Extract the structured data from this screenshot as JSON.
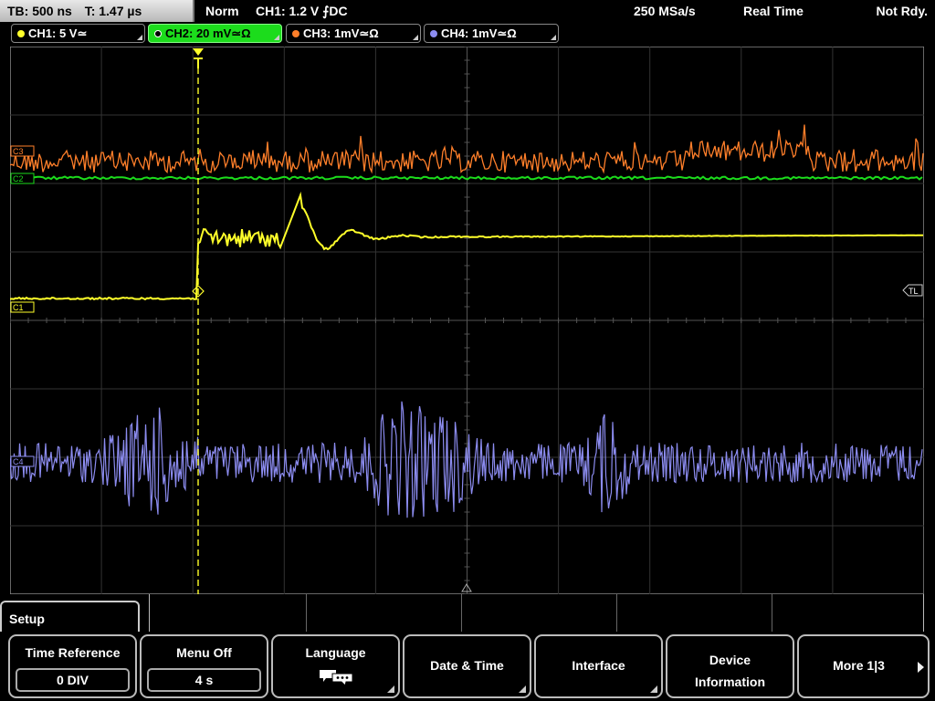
{
  "status": {
    "timebase": "TB: 500 ns",
    "trigger_time": "T: 1.47 µs",
    "trigger_mode": "Norm",
    "trigger_info": "CH1: 1.2 V ⨍DC",
    "sample_rate": "250 MSa/s",
    "acq_mode": "Real Time",
    "state": "Not Rdy."
  },
  "channels": [
    {
      "label": "CH1: 5 V≃",
      "color": "#ffff2a",
      "active": false
    },
    {
      "label": "CH2: 20 mV≃Ω",
      "color": "#1cdc1c",
      "active": true
    },
    {
      "label": "CH3: 1mV≃Ω",
      "color": "#ff7f2a",
      "active": false
    },
    {
      "label": "CH4: 1mV≃Ω",
      "color": "#8c8cf0",
      "active": false
    }
  ],
  "markers": {
    "c3": "C3",
    "c2": "C2",
    "c1": "C1",
    "c4": "C4",
    "trigger_level": "TL"
  },
  "menu": {
    "title": "Setup",
    "softkeys": [
      {
        "label": "Time Reference",
        "value": "0 DIV"
      },
      {
        "label": "Menu Off",
        "value": "4 s"
      },
      {
        "label": "Language",
        "icon": "speech-bubbles-icon"
      },
      {
        "label": "Date & Time"
      },
      {
        "label": "Interface"
      },
      {
        "label_line1": "Device",
        "label_line2": "Information"
      },
      {
        "label": "More 1|3"
      }
    ]
  }
}
